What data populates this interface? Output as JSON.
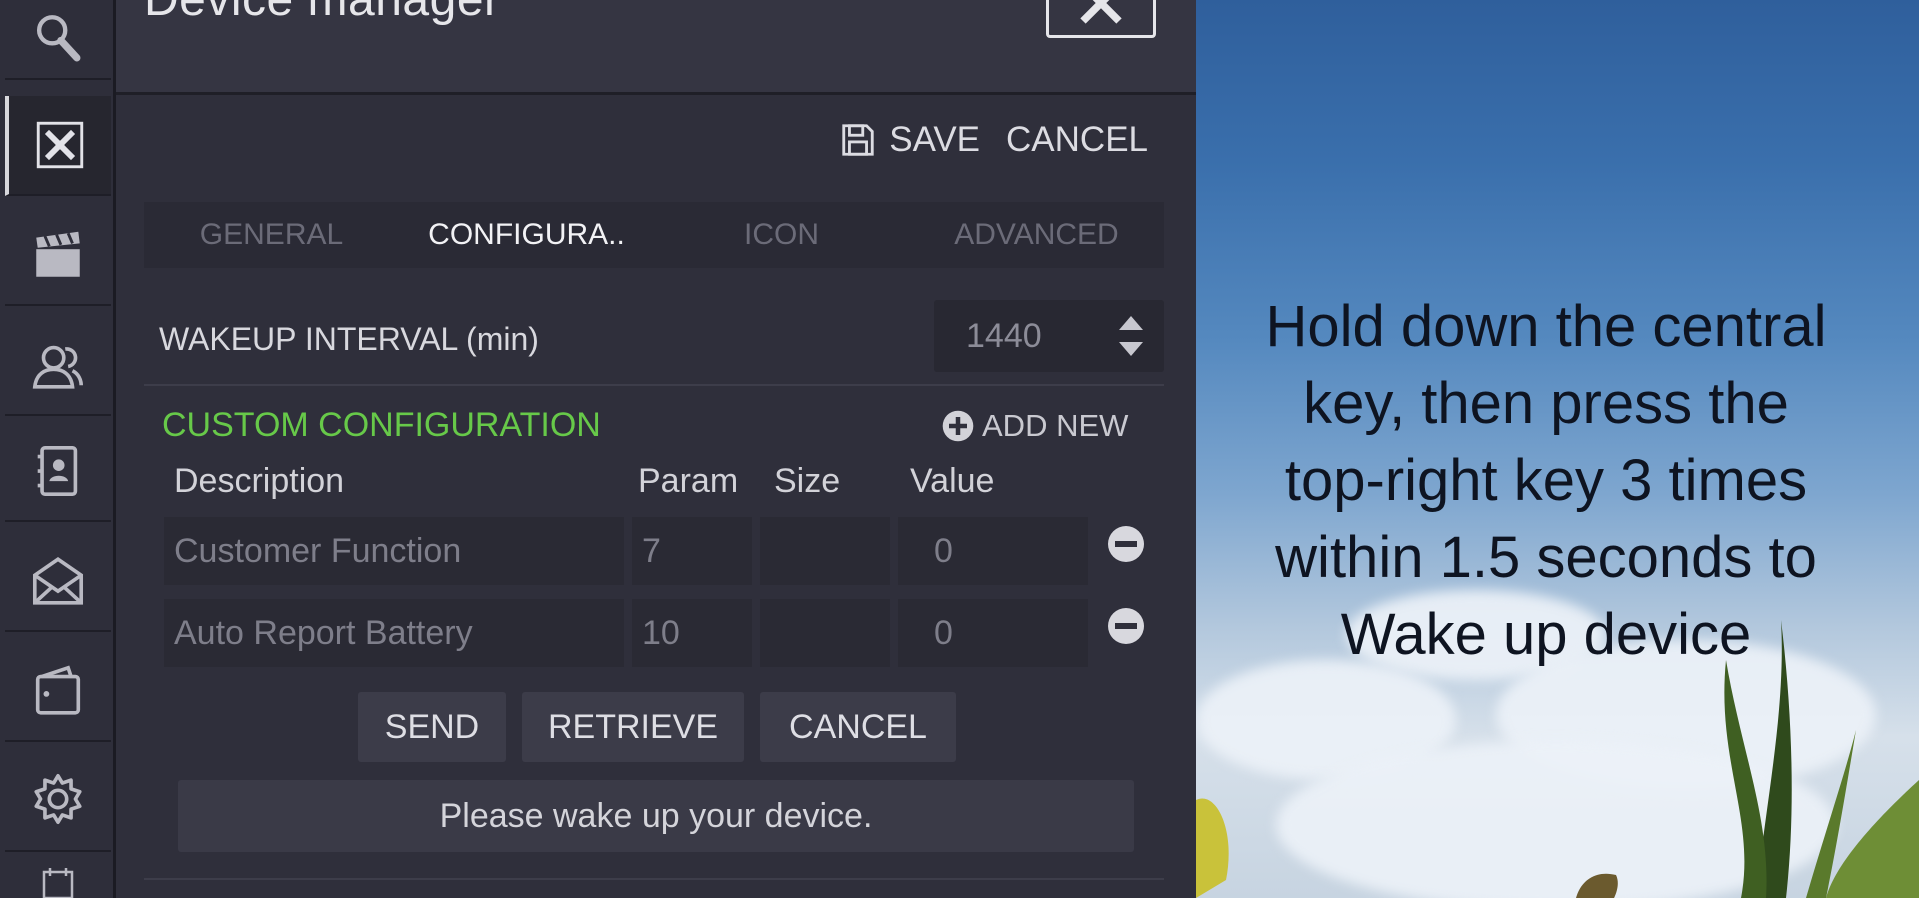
{
  "rail": {
    "items": [
      {
        "name": "search-icon"
      },
      {
        "name": "device-manager-icon",
        "active": true
      },
      {
        "name": "scenes-clapperboard-icon"
      },
      {
        "name": "users-icon"
      },
      {
        "name": "contacts-book-icon"
      },
      {
        "name": "messages-envelope-icon"
      },
      {
        "name": "wallet-icon"
      },
      {
        "name": "settings-gear-icon"
      },
      {
        "name": "calendar-icon"
      }
    ]
  },
  "panel": {
    "title": "Device manager",
    "save_label": "SAVE",
    "cancel_label": "CANCEL",
    "tabs": [
      {
        "label": "GENERAL",
        "active": false
      },
      {
        "label": "CONFIGURA..",
        "active": true
      },
      {
        "label": "ICON",
        "active": false
      },
      {
        "label": "ADVANCED",
        "active": false
      }
    ],
    "wakeup": {
      "label": "WAKEUP INTERVAL (min)",
      "value": "1440"
    },
    "custom": {
      "label": "CUSTOM CONFIGURATION",
      "add_new_label": "ADD NEW",
      "columns": [
        "Description",
        "Param",
        "Size",
        "Value"
      ],
      "rows": [
        {
          "description": "Customer Function",
          "param": "7",
          "size": "",
          "value": "0"
        },
        {
          "description": "Auto Report Battery",
          "param": "10",
          "size": "",
          "value": "0"
        }
      ]
    },
    "buttons": {
      "send": "SEND",
      "retrieve": "RETRIEVE",
      "cancel": "CANCEL"
    },
    "status": "Please wake up your device."
  },
  "instruction": {
    "lines": [
      "Hold down the central",
      "key, then press the",
      "top-right key 3 times",
      "within 1.5 seconds to",
      "Wake up device"
    ]
  },
  "colors": {
    "accent_green": "#67c949",
    "panel_bg": "#2f2f3b",
    "rail_bg": "#2e2e3a"
  }
}
